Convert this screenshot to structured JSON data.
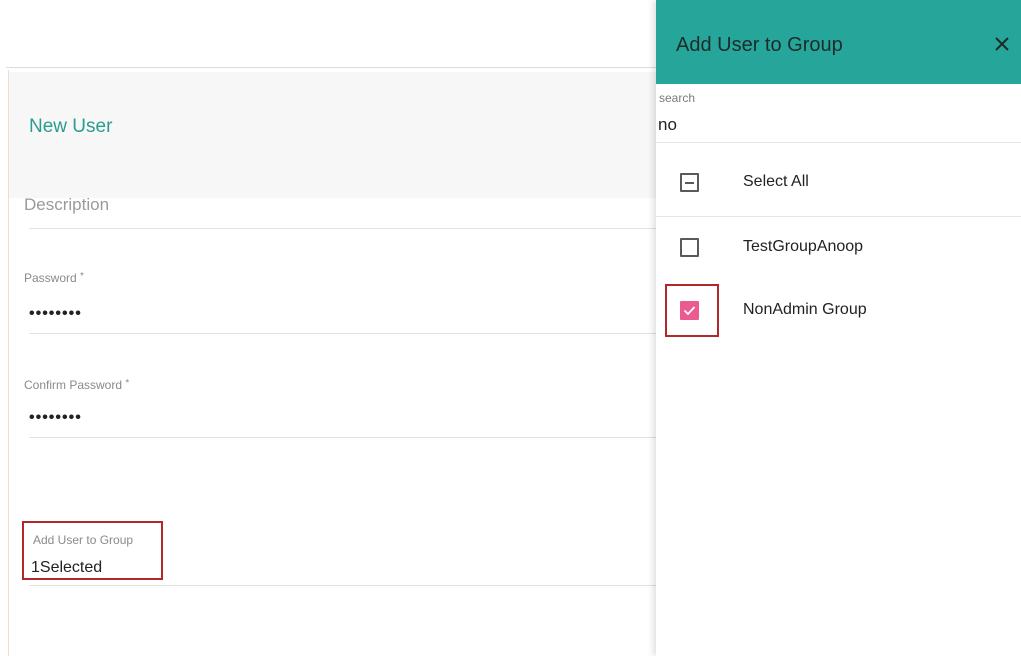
{
  "form": {
    "title": "New User",
    "description_label": "Description",
    "password": {
      "label": "Password",
      "required_mark": "*",
      "value": "••••••••"
    },
    "confirm_password": {
      "label": "Confirm Password",
      "required_mark": "*",
      "value": "••••••••"
    },
    "add_user_to_group": {
      "label": "Add User to Group",
      "value": "1Selected"
    }
  },
  "panel": {
    "title": "Add User to Group",
    "close_icon": "close-icon",
    "search": {
      "label": "search",
      "value": "no"
    },
    "select_all": {
      "label": "Select All",
      "state": "indeterminate"
    },
    "options": [
      {
        "label": "TestGroupAnoop",
        "checked": false
      },
      {
        "label": "NonAdmin Group",
        "checked": true
      }
    ]
  },
  "colors": {
    "accent_teal": "#26a69a",
    "title_teal": "#2a9d8f",
    "checkbox_pink": "#ec5b8f",
    "highlight_red": "#b3262b"
  }
}
